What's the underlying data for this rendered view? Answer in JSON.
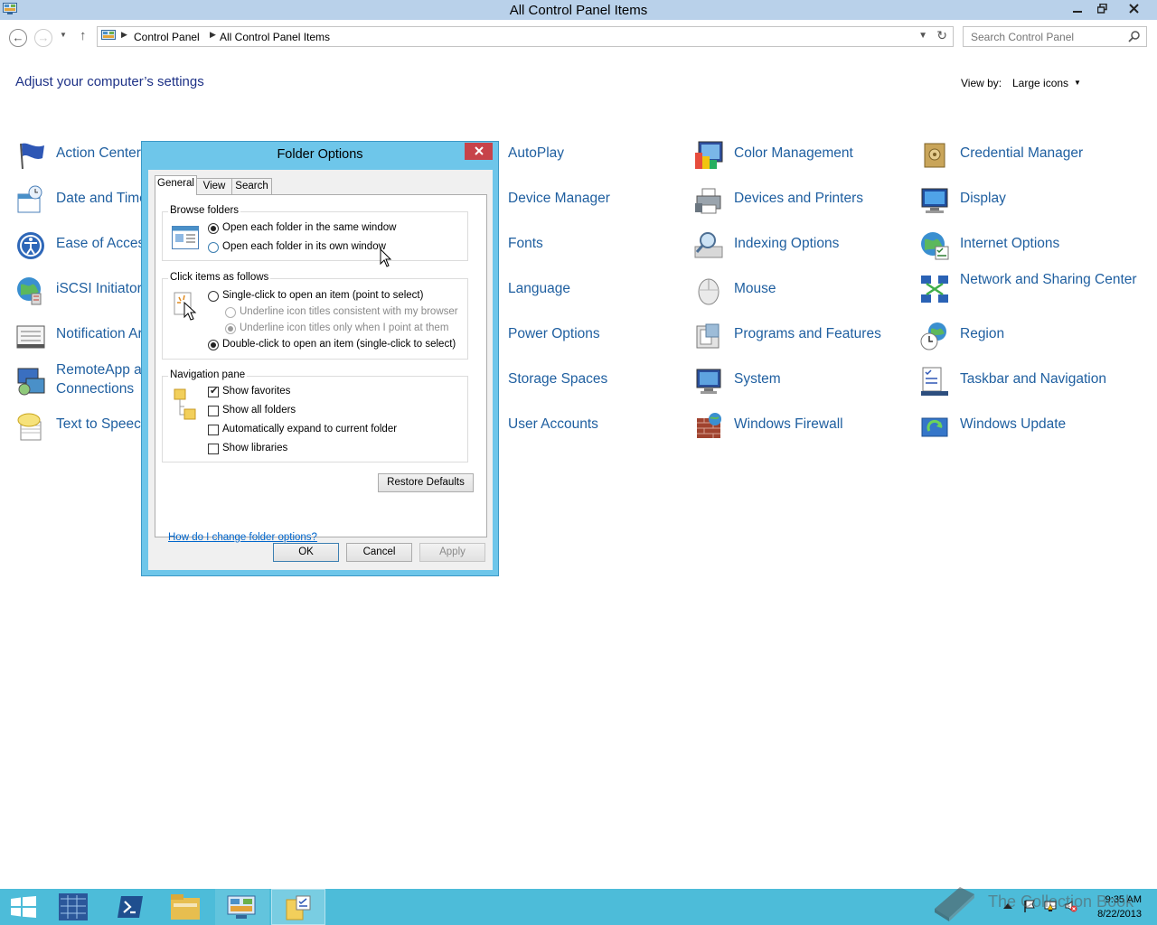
{
  "window": {
    "title": "All Control Panel Items",
    "minimize_icon": "minimize-icon",
    "maximize_icon": "restore-icon",
    "close_icon": "close-icon"
  },
  "navigation": {
    "back_icon": "back-arrow-icon",
    "forward_icon": "forward-arrow-icon",
    "up_icon": "up-arrow-icon",
    "breadcrumb": [
      "Control Panel",
      "All Control Panel Items"
    ],
    "search_placeholder": "Search Control Panel"
  },
  "content": {
    "heading": "Adjust your computer’s settings",
    "view_by_label": "View by:",
    "view_by_value": "Large icons"
  },
  "items": [
    {
      "label": "Action Center",
      "icon": "flag-icon"
    },
    {
      "label": "AutoPlay",
      "icon": "autoplay-icon"
    },
    {
      "label": "Color Management",
      "icon": "color-management-icon"
    },
    {
      "label": "Credential Manager",
      "icon": "credential-vault-icon"
    },
    {
      "label": "Date and Time",
      "icon": "calendar-clock-icon"
    },
    {
      "label": "Device Manager",
      "icon": "device-manager-icon"
    },
    {
      "label": "Devices and Printers",
      "icon": "printer-icon"
    },
    {
      "label": "Display",
      "icon": "monitor-icon"
    },
    {
      "label": "Ease of Access",
      "icon": "ease-of-access-icon"
    },
    {
      "label": "Fonts",
      "icon": "fonts-icon"
    },
    {
      "label": "Indexing Options",
      "icon": "indexing-icon"
    },
    {
      "label": "Internet Options",
      "icon": "globe-icon"
    },
    {
      "label": "iSCSI Initiator",
      "icon": "iscsi-globe-icon"
    },
    {
      "label": "Language",
      "icon": "language-icon"
    },
    {
      "label": "Mouse",
      "icon": "mouse-icon"
    },
    {
      "label": "Network and Sharing Center",
      "icon": "network-icon"
    },
    {
      "label": "Notification Area Icons",
      "icon": "notification-area-icon"
    },
    {
      "label": "Power Options",
      "icon": "power-icon"
    },
    {
      "label": "Programs and Features",
      "icon": "programs-icon"
    },
    {
      "label": "Region",
      "icon": "region-clock-icon"
    },
    {
      "label": "RemoteApp and Desktop Connections",
      "icon": "remoteapp-icon"
    },
    {
      "label": "Storage Spaces",
      "icon": "storage-icon"
    },
    {
      "label": "System",
      "icon": "system-icon"
    },
    {
      "label": "Taskbar and Navigation",
      "icon": "taskbar-icon"
    },
    {
      "label": "Text to Speech",
      "icon": "speech-bubble-icon"
    },
    {
      "label": "User Accounts",
      "icon": "user-accounts-icon"
    },
    {
      "label": "Windows Firewall",
      "icon": "firewall-icon"
    },
    {
      "label": "Windows Update",
      "icon": "windows-update-icon"
    }
  ],
  "dialog": {
    "title": "Folder Options",
    "close_icon": "close-icon",
    "tabs": [
      "General",
      "View",
      "Search"
    ],
    "active_tab": "General",
    "browse_folders": {
      "label": "Browse folders",
      "options": [
        "Open each folder in the same window",
        "Open each folder in its own window"
      ],
      "selected": 0
    },
    "click_items": {
      "label": "Click items as follows",
      "single_click": "Single-click to open an item (point to select)",
      "underline_browser": "Underline icon titles consistent with my browser",
      "underline_point": "Underline icon titles only when I point at them",
      "double_click": "Double-click to open an item (single-click to select)",
      "selected": "double_click"
    },
    "navigation_pane": {
      "label": "Navigation pane",
      "options": [
        {
          "label": "Show favorites",
          "checked": true
        },
        {
          "label": "Show all folders",
          "checked": false
        },
        {
          "label": "Automatically expand to current folder",
          "checked": false
        },
        {
          "label": "Show libraries",
          "checked": false
        }
      ]
    },
    "restore_defaults": "Restore Defaults",
    "help_link": "How do I change folder options?",
    "ok": "OK",
    "cancel": "Cancel",
    "apply": "Apply"
  },
  "taskbar": {
    "items": [
      "start-icon",
      "server-manager-icon",
      "powershell-icon",
      "file-explorer-icon",
      "control-panel-icon",
      "folder-options-icon"
    ],
    "time": "9:35 AM",
    "date": "8/22/2013",
    "watermark": "The Collection Book"
  },
  "colors": {
    "titlebar": "#b9d1ea",
    "link": "#1f5fa0",
    "heading": "#1e3287",
    "dialog_frame": "#6ec6ea",
    "taskbar": "#4dbcd9"
  }
}
